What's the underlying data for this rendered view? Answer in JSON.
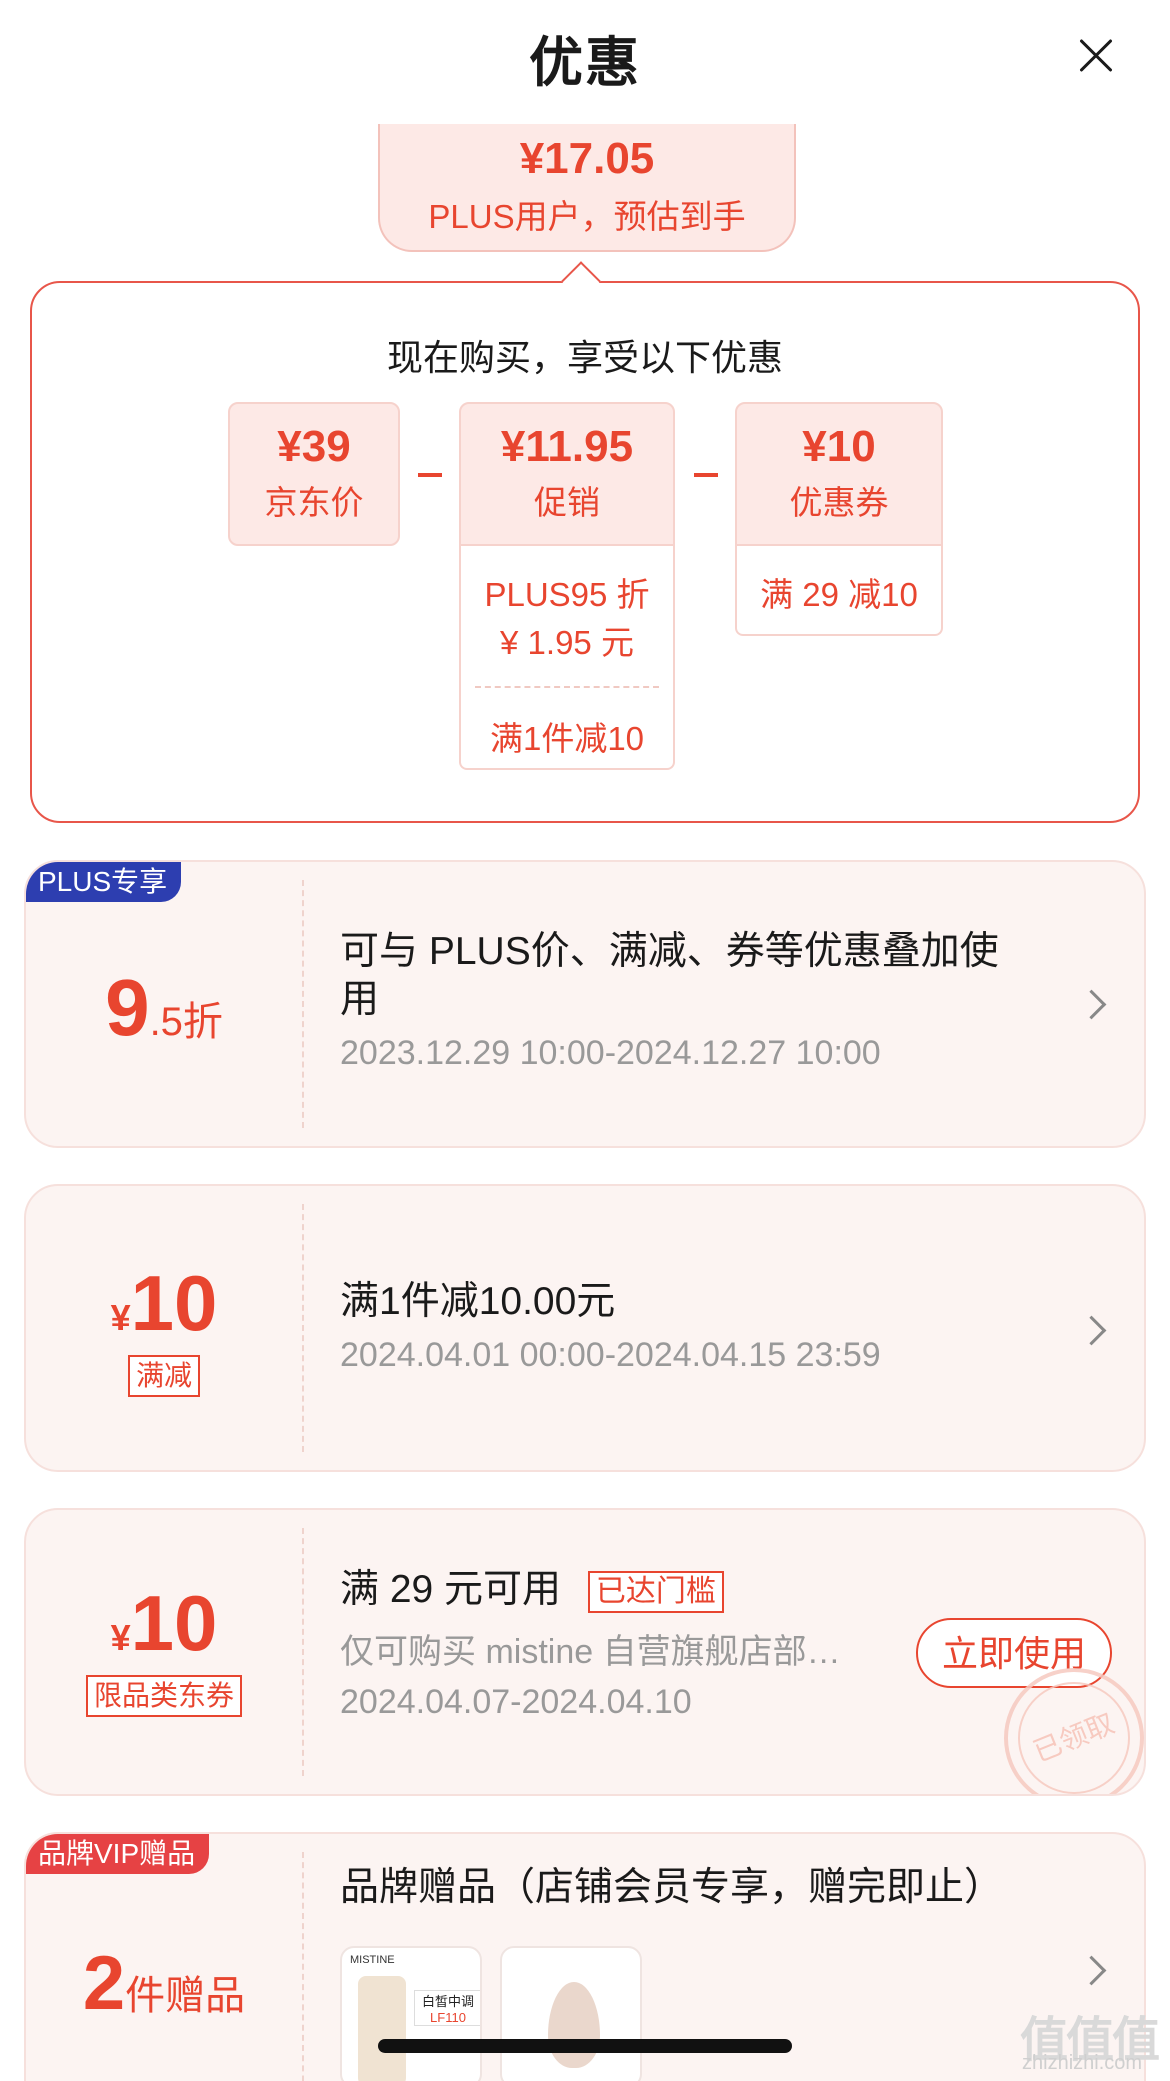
{
  "header": {
    "title": "优惠"
  },
  "estimate": {
    "price": "¥17.05",
    "label": "PLUS用户，预估到手"
  },
  "summary": {
    "heading": "现在购买，享受以下优惠",
    "items": [
      {
        "amount": "¥39",
        "name": "京东价"
      },
      {
        "amount": "¥11.95",
        "name": "促销",
        "details": [
          "PLUS95 折",
          "¥ 1.95 元",
          "满1件减10"
        ]
      },
      {
        "amount": "¥10",
        "name": "优惠券",
        "details": [
          "满 29 减10"
        ]
      }
    ]
  },
  "coupons": [
    {
      "ribbon": "PLUS专享",
      "value_main": "9",
      "value_suffix": ".5折",
      "desc": "可与 PLUS价、满减、券等优惠叠加使用",
      "date": "2023.12.29 10:00-2024.12.27 10:00"
    },
    {
      "currency": "¥",
      "value_main": "10",
      "tag": "满减",
      "desc": "满1件减10.00元",
      "date": "2024.04.01 00:00-2024.04.15 23:59"
    },
    {
      "currency": "¥",
      "value_main": "10",
      "tag": "限品类东券",
      "desc": "满 29 元可用",
      "badge": "已达门槛",
      "scope": "仅可购买 mistine 自营旗舰店部…",
      "date": "2024.04.07-2024.04.10",
      "button": "立即使用",
      "stamp": "已领取"
    },
    {
      "ribbon": "品牌VIP赠品",
      "value_main": "2",
      "value_suffix": "件赠品",
      "desc": "品牌赠品（店铺会员专享，赠完即止）",
      "gift1": {
        "brand": "MISTINE",
        "label": "白皙中调",
        "code": "LF110"
      }
    }
  ],
  "watermark": {
    "text": "值值值",
    "site": "zhizhizhi.com"
  },
  "colors": {
    "accent": "#e8452f",
    "plus": "#2d3eb0",
    "vip": "#e64244"
  },
  "icons": [
    "close-icon",
    "chevron-right-icon"
  ]
}
